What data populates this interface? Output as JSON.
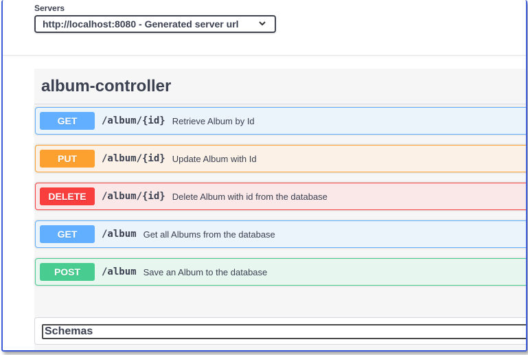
{
  "servers": {
    "label": "Servers",
    "selected": "http://localhost:8080 - Generated server url",
    "chevron_icon": "chevron-down-icon"
  },
  "tag": {
    "title": "album-controller"
  },
  "operations": [
    {
      "method": "GET",
      "path": "/album/{id}",
      "summary": "Retrieve Album by Id"
    },
    {
      "method": "PUT",
      "path": "/album/{id}",
      "summary": "Update Album with Id"
    },
    {
      "method": "DELETE",
      "path": "/album/{id}",
      "summary": "Delete Album with id from the database"
    },
    {
      "method": "GET",
      "path": "/album",
      "summary": "Get all Albums from the database"
    },
    {
      "method": "POST",
      "path": "/album",
      "summary": "Save an Album to the database"
    }
  ],
  "schemas": {
    "label": "Schemas"
  },
  "colors": {
    "get": "#61affe",
    "put": "#fca130",
    "delete": "#f93e3e",
    "post": "#49cc90",
    "frame_border": "#3b5bd9"
  }
}
